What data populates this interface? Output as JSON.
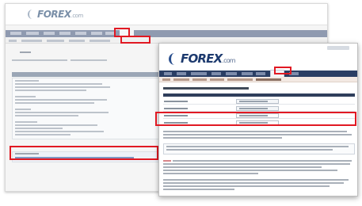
{
  "back_window": {
    "brand": "FOREX",
    "brand_suffix": ".com",
    "highlight_colors": {
      "accent": "#e11923",
      "nav": "#8f9ab0"
    }
  },
  "front_window": {
    "brand": "FOREX",
    "brand_suffix": ".com",
    "colors": {
      "nav": "#2a3e64",
      "subnav": "#f3e9e3",
      "header": "#2f3e5b"
    }
  },
  "icons": [
    "forex-logo-icon"
  ]
}
